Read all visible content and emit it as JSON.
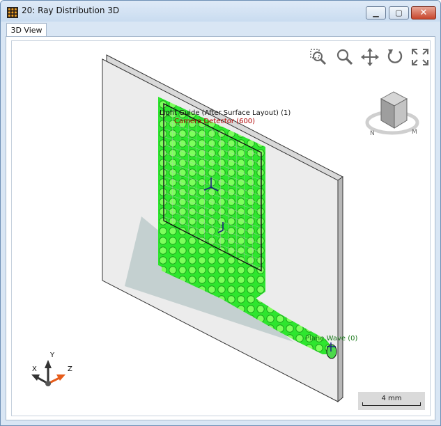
{
  "window": {
    "title": "20: Ray Distribution 3D",
    "minimize_icon": "minimize-icon",
    "maximize_icon": "maximize-icon",
    "close_icon": "close-icon"
  },
  "tabs": [
    {
      "label": "3D View"
    }
  ],
  "toolbar": {
    "icons": [
      "zoom-fit-icon",
      "zoom-icon",
      "pan-icon",
      "rotate-icon",
      "fullscreen-icon"
    ]
  },
  "scene": {
    "labels": {
      "light_guide": "Light Guide (After Surface Layout) (1)",
      "camera_detector": "Camera Detector (600)",
      "plane_wave": "Plane Wave (0)"
    },
    "colors": {
      "rays": "#33ff33",
      "camera_label": "#b00000",
      "plane_wave_label": "#1a7a1a"
    }
  },
  "axes": {
    "x": "X",
    "y": "Y",
    "z": "Z"
  },
  "scale_bar": {
    "label": "4 mm"
  },
  "orientation_cube": {
    "icon": "view-cube-icon"
  }
}
